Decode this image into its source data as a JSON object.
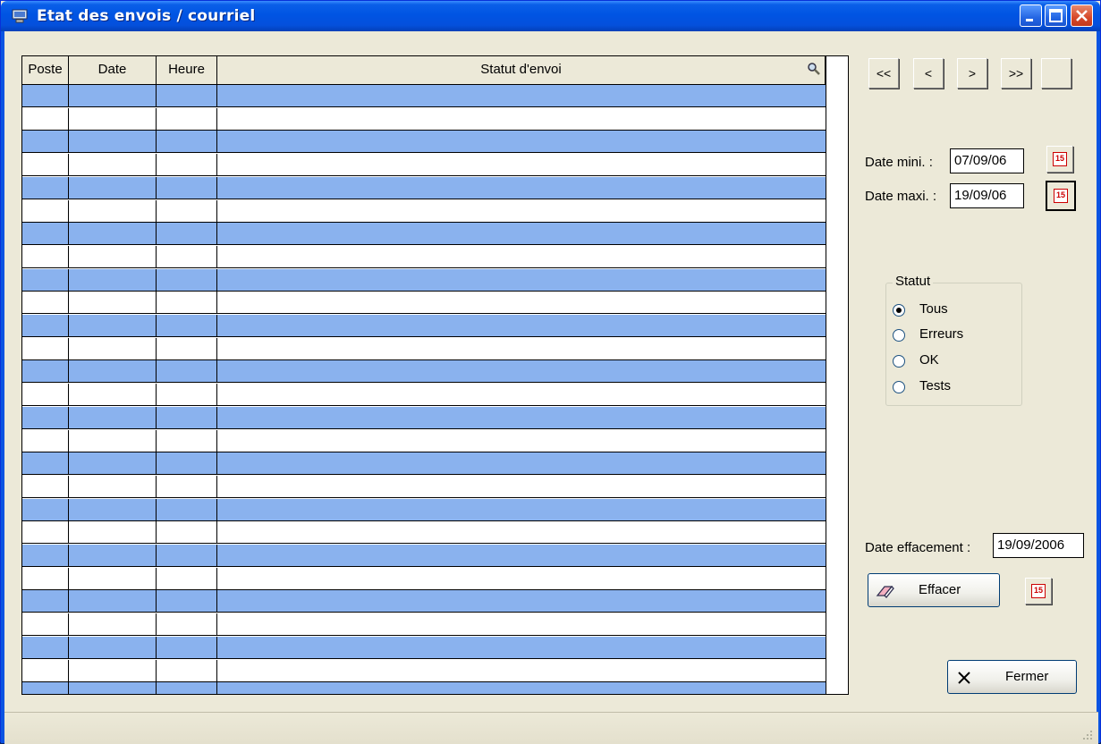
{
  "window": {
    "title": "Etat des envois / courriel",
    "icon": "computer-icon",
    "controls": [
      "minimize-icon",
      "maximize-icon",
      "close-icon"
    ]
  },
  "grid": {
    "columns": [
      "Poste",
      "Date",
      "Heure",
      "Statut d'envoi"
    ],
    "search_icon": "magnifier-icon",
    "rows": 27,
    "row_colors": [
      "#8ab2ee",
      "#ffffff"
    ]
  },
  "navigation": {
    "first": "<<",
    "prev": "<",
    "next": ">",
    "last": ">>",
    "extra": ""
  },
  "date_filter": {
    "min_label": "Date mini. :",
    "min_value": "07/09/06",
    "max_label": "Date maxi. :",
    "max_value": "19/09/06",
    "calendar_icon_text": "15"
  },
  "statut": {
    "title": "Statut",
    "options": [
      "Tous",
      "Erreurs",
      "OK",
      "Tests"
    ],
    "selected": "Tous"
  },
  "effacement": {
    "label": "Date effacement :",
    "value": "19/09/2006",
    "button": "Effacer"
  },
  "close_button": "Fermer"
}
